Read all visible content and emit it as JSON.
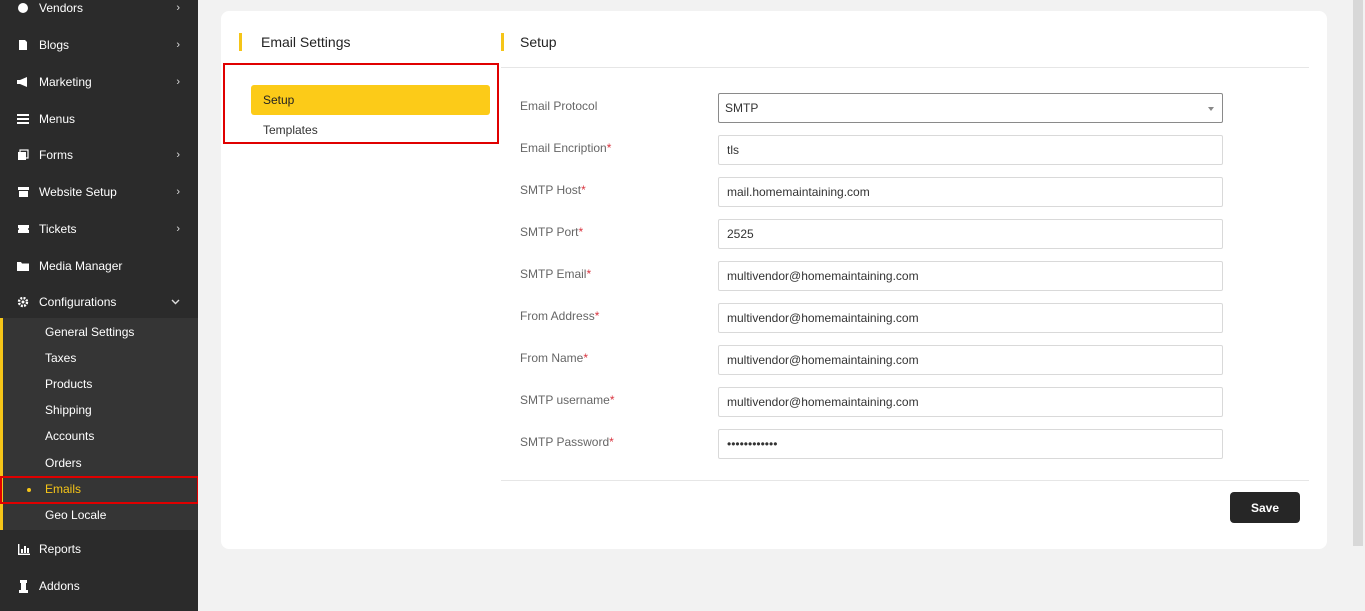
{
  "sidebar": {
    "items": [
      {
        "label": "Vendors",
        "icon": "vendors-icon"
      },
      {
        "label": "Blogs",
        "icon": "blogs-icon"
      },
      {
        "label": "Marketing",
        "icon": "megaphone-icon"
      },
      {
        "label": "Menus",
        "icon": "menu-icon"
      },
      {
        "label": "Forms",
        "icon": "forms-icon"
      },
      {
        "label": "Website Setup",
        "icon": "store-icon"
      },
      {
        "label": "Tickets",
        "icon": "ticket-icon"
      },
      {
        "label": "Media Manager",
        "icon": "folder-icon"
      },
      {
        "label": "Configurations",
        "icon": "gear-icon"
      },
      {
        "label": "Reports",
        "icon": "chart-icon"
      },
      {
        "label": "Addons",
        "icon": "puzzle-icon"
      }
    ],
    "configurations_submenu": [
      {
        "label": "General Settings"
      },
      {
        "label": "Taxes"
      },
      {
        "label": "Products"
      },
      {
        "label": "Shipping"
      },
      {
        "label": "Accounts"
      },
      {
        "label": "Orders"
      },
      {
        "label": "Emails",
        "active": true
      },
      {
        "label": "Geo Locale"
      }
    ]
  },
  "email_settings": {
    "title": "Email Settings",
    "tabs": [
      {
        "label": "Setup",
        "active": true
      },
      {
        "label": "Templates"
      }
    ]
  },
  "setup": {
    "title": "Setup",
    "fields": {
      "protocol": {
        "label": "Email Protocol",
        "value": "SMTP"
      },
      "encryption": {
        "label": "Email Encription",
        "value": "tls"
      },
      "host": {
        "label": "SMTP Host",
        "value": "mail.homemaintaining.com"
      },
      "port": {
        "label": "SMTP Port",
        "value": "2525"
      },
      "email": {
        "label": "SMTP Email",
        "value": "multivendor@homemaintaining.com"
      },
      "from_address": {
        "label": "From Address",
        "value": "multivendor@homemaintaining.com"
      },
      "from_name": {
        "label": "From Name",
        "value": "multivendor@homemaintaining.com"
      },
      "username": {
        "label": "SMTP username",
        "value": "multivendor@homemaintaining.com"
      },
      "password": {
        "label": "SMTP Password",
        "value": "password1234"
      }
    },
    "required_mark": "*",
    "save_label": "Save"
  },
  "colors": {
    "accent": "#fccb18",
    "sidebar_bg": "#2b2b2b",
    "highlight_box": "#e00000",
    "button_bg": "#262626"
  }
}
